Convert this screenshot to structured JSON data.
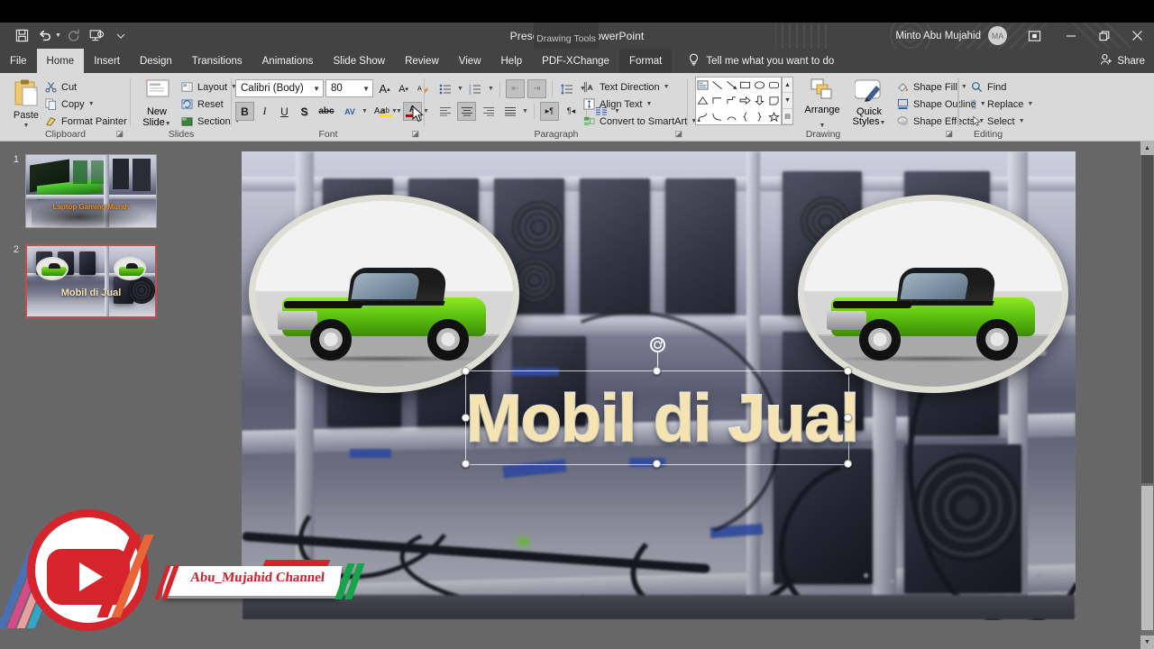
{
  "window": {
    "title": "Presentation1  -  PowerPoint",
    "contextual_tab_group": "Drawing Tools",
    "user_name": "Minto Abu Mujahid",
    "user_initials": "MA",
    "ribbon_display_options_icon": "ribbon-display-options-icon",
    "minimize_icon": "minimize-icon",
    "restore_icon": "restore-icon",
    "close_icon": "close-icon"
  },
  "quick_access": [
    {
      "name": "save",
      "icon": "save-icon",
      "enabled": true,
      "has_caret": false
    },
    {
      "name": "undo",
      "icon": "undo-icon",
      "enabled": true,
      "has_caret": true
    },
    {
      "name": "redo",
      "icon": "redo-icon",
      "enabled": false,
      "has_caret": false
    },
    {
      "name": "start-from-beginning",
      "icon": "slideshow-icon",
      "enabled": true,
      "has_caret": false
    },
    {
      "name": "customize-quick-access-toolbar",
      "icon": "chevron-down-icon",
      "enabled": true,
      "has_caret": false
    }
  ],
  "tabs": [
    {
      "label": "File",
      "active": false,
      "contextual": false
    },
    {
      "label": "Home",
      "active": true,
      "contextual": false
    },
    {
      "label": "Insert",
      "active": false,
      "contextual": false
    },
    {
      "label": "Design",
      "active": false,
      "contextual": false
    },
    {
      "label": "Transitions",
      "active": false,
      "contextual": false
    },
    {
      "label": "Animations",
      "active": false,
      "contextual": false
    },
    {
      "label": "Slide Show",
      "active": false,
      "contextual": false
    },
    {
      "label": "Review",
      "active": false,
      "contextual": false
    },
    {
      "label": "View",
      "active": false,
      "contextual": false
    },
    {
      "label": "Help",
      "active": false,
      "contextual": false
    },
    {
      "label": "PDF-XChange",
      "active": false,
      "contextual": false
    },
    {
      "label": "Format",
      "active": false,
      "contextual": true
    }
  ],
  "tell_me": {
    "label": "Tell me what you want to do",
    "icon": "lightbulb-icon"
  },
  "share": {
    "label": "Share",
    "icon": "share-person-icon"
  },
  "ribbon": {
    "clipboard": {
      "title": "Clipboard",
      "paste_label": "Paste",
      "items": [
        {
          "label": "Cut",
          "icon": "scissors-icon"
        },
        {
          "label": "Copy",
          "icon": "copy-icon",
          "has_caret": true
        },
        {
          "label": "Format Painter",
          "icon": "format-painter-icon"
        }
      ]
    },
    "slides": {
      "title": "Slides",
      "new_slide_label": "New\nSlide",
      "new_slide_line1": "New",
      "new_slide_line2": "Slide",
      "items": [
        {
          "label": "Layout",
          "icon": "layout-icon",
          "has_caret": true
        },
        {
          "label": "Reset",
          "icon": "reset-icon",
          "has_caret": false
        },
        {
          "label": "Section",
          "icon": "section-icon",
          "has_caret": true
        }
      ]
    },
    "font": {
      "title": "Font",
      "font_name": "Calibri (Body)",
      "font_size": "80",
      "grow_font": "A",
      "shrink_font": "A",
      "clear_formatting_icon": "clear-formatting-icon",
      "buttons": [
        {
          "name": "bold",
          "glyph": "B",
          "active": true
        },
        {
          "name": "italic",
          "glyph": "I",
          "active": false
        },
        {
          "name": "underline",
          "glyph": "U",
          "active": false
        },
        {
          "name": "text-shadow",
          "glyph": "S",
          "active": false
        },
        {
          "name": "strikethrough",
          "glyph": "abc",
          "active": false
        },
        {
          "name": "character-spacing",
          "glyph": "AV",
          "active": false,
          "has_caret": true
        },
        {
          "name": "change-case",
          "glyph": "Aa",
          "active": false,
          "has_caret": true
        },
        {
          "name": "text-highlight-color",
          "glyph": "ab",
          "active": false,
          "has_caret": true
        },
        {
          "name": "font-color",
          "glyph": "A",
          "active": false,
          "has_caret": true
        }
      ]
    },
    "paragraph": {
      "title": "Paragraph",
      "items": [
        {
          "label": "Text Direction",
          "icon": "text-direction-icon",
          "has_caret": true
        },
        {
          "label": "Align Text",
          "icon": "align-text-icon",
          "has_caret": true
        },
        {
          "label": "Convert to SmartArt",
          "icon": "smartart-icon",
          "has_caret": true
        }
      ]
    },
    "drawing": {
      "title": "Drawing",
      "arrange_label": "Arrange",
      "quick_styles_line1": "Quick",
      "quick_styles_line2": "Styles",
      "items": [
        {
          "label": "Shape Fill",
          "icon": "shape-fill-icon",
          "has_caret": true
        },
        {
          "label": "Shape Outline",
          "icon": "shape-outline-icon",
          "has_caret": true
        },
        {
          "label": "Shape Effects",
          "icon": "shape-effects-icon",
          "has_caret": true
        }
      ]
    },
    "editing": {
      "title": "Editing",
      "items": [
        {
          "label": "Find",
          "icon": "search-icon",
          "has_caret": false
        },
        {
          "label": "Replace",
          "icon": "replace-icon",
          "has_caret": true
        },
        {
          "label": "Select",
          "icon": "select-pointer-icon",
          "has_caret": true
        }
      ]
    }
  },
  "slides_panel": [
    {
      "number": "1",
      "caption": "Laptop Gaming Murah",
      "caption_color": "#f0921e",
      "selected": false
    },
    {
      "number": "2",
      "caption": "Mobil di Jual",
      "caption_color": "#f5e3b2",
      "selected": true
    }
  ],
  "slide": {
    "title_text": "Mobil di Jual",
    "title_color": "#f5e3b2",
    "title_outline_color": "#ffffff",
    "selected": true,
    "pictures": [
      {
        "name": "car-photo-left",
        "alt": "green muscle car in oval frame"
      },
      {
        "name": "car-photo-right",
        "alt": "green muscle car in oval frame"
      }
    ],
    "background_alt": "crypto mining rig with graphics cards and cables"
  },
  "watermark": {
    "youtube_logo": "youtube-play-logo",
    "channel_name": "Abu_Mujahid Channel"
  },
  "colors": {
    "ribbon_bg": "#d9d9d9",
    "titlebar_bg": "#434343",
    "accent_red": "#d5242c",
    "selection_border": "#c0504d",
    "title_cream": "#f5e3b2"
  }
}
